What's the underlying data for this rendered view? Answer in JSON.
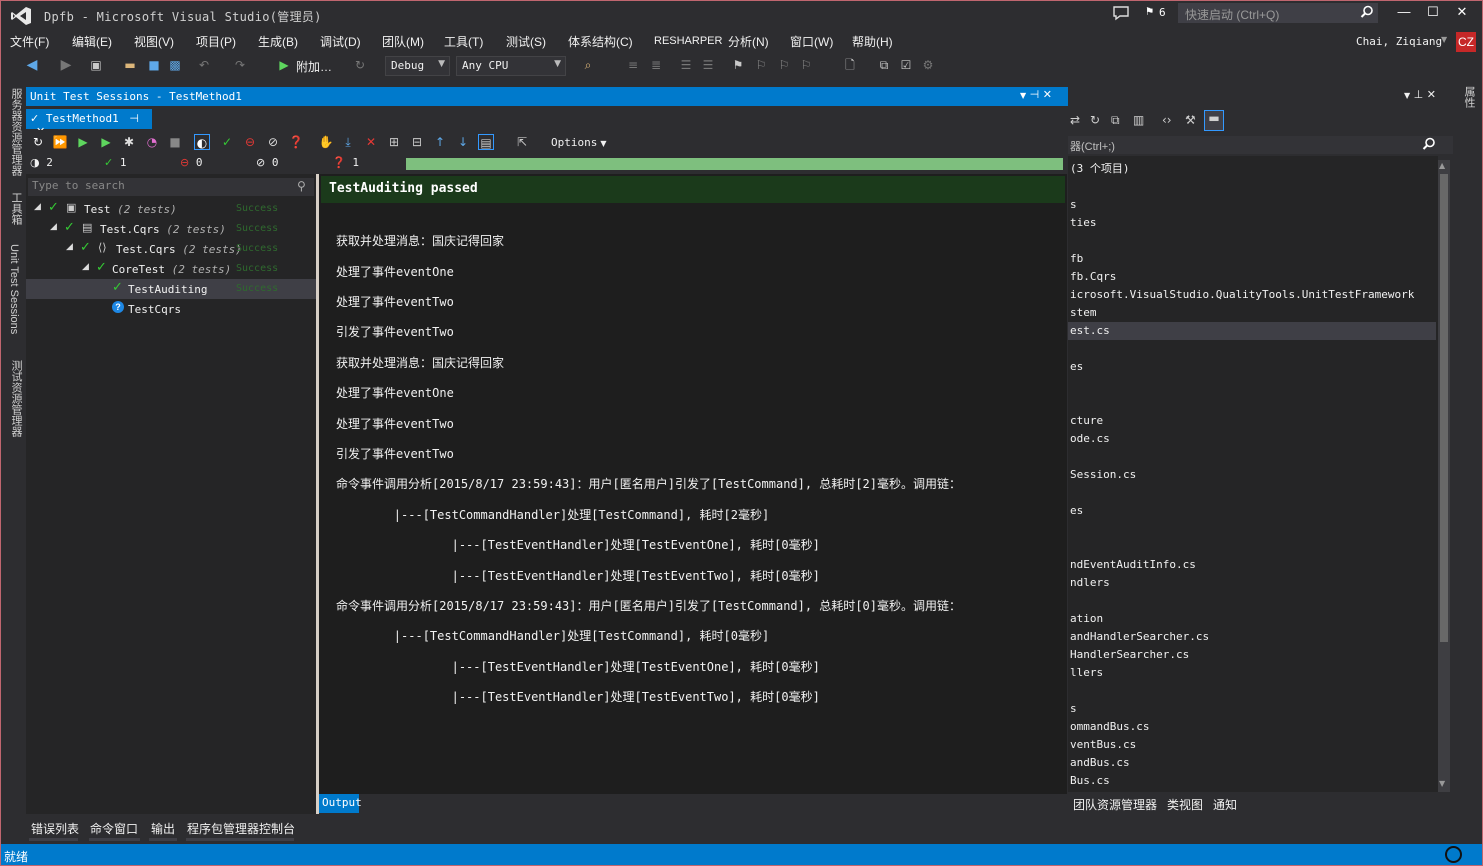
{
  "window": {
    "title": "Dpfb - Microsoft Visual Studio(管理员)",
    "notifications_count": "6",
    "quick_launch_placeholder": "快速启动 (Ctrl+Q)",
    "minimize": "—",
    "maximize": "☐",
    "close": "✕"
  },
  "menu": [
    "文件(F)",
    "编辑(E)",
    "视图(V)",
    "项目(P)",
    "生成(B)",
    "调试(D)",
    "团队(M)",
    "工具(T)",
    "测试(S)",
    "体系结构(C)",
    "RESHARPER",
    "分析(N)",
    "窗口(W)",
    "帮助(H)"
  ],
  "user": {
    "name": "Chai, Ziqiang",
    "initials": "CZ"
  },
  "toolbar": {
    "attach": "附加…",
    "configuration": "Debug",
    "platform": "Any CPU"
  },
  "left_tabs": [
    "服务器资源管理器",
    "工具箱",
    "Unit Test Sessions",
    "测试资源管理器"
  ],
  "right_tab": "属性",
  "unit_test": {
    "window_title": "Unit Test Sessions - TestMethod1",
    "tab_label": "TestMethod1",
    "options_label": "Options",
    "counts": {
      "total": "2",
      "passed": "1",
      "failed": "0",
      "ignored": "0",
      "unknown": "1"
    },
    "progress_fraction": 1.0,
    "search_placeholder": "Type to search",
    "tree": [
      {
        "label": "Test",
        "count": "(2 tests)",
        "result": "Success"
      },
      {
        "label": "Test.Cqrs",
        "count": "(2 tests)",
        "result": "Success"
      },
      {
        "label": "Test.Cqrs",
        "count": "(2 tests)",
        "result": "Success"
      },
      {
        "label": "CoreTest",
        "count": "(2 tests)",
        "result": "Success"
      },
      {
        "label": "TestAuditing",
        "count": "",
        "result": "Success"
      },
      {
        "label": "TestCqrs",
        "count": "",
        "result": ""
      }
    ],
    "output_header": "TestAuditing passed",
    "output_lines": [
      "获取并处理消息：国庆记得回家",
      "处理了事件eventOne",
      "处理了事件eventTwo",
      "引发了事件eventTwo",
      "获取并处理消息：国庆记得回家",
      "处理了事件eventOne",
      "处理了事件eventTwo",
      "引发了事件eventTwo",
      "命令事件调用分析[2015/8/17 23:59:43]：用户[匿名用户]引发了[TestCommand], 总耗时[2]毫秒。调用链：",
      "        |---[TestCommandHandler]处理[TestCommand], 耗时[2毫秒]",
      "                |---[TestEventHandler]处理[TestEventOne], 耗时[0毫秒]",
      "                |---[TestEventHandler]处理[TestEventTwo], 耗时[0毫秒]",
      "命令事件调用分析[2015/8/17 23:59:43]：用户[匿名用户]引发了[TestCommand], 总耗时[0]毫秒。调用链：",
      "        |---[TestCommandHandler]处理[TestCommand], 耗时[0毫秒]",
      "                |---[TestEventHandler]处理[TestEventOne], 耗时[0毫秒]",
      "                |---[TestEventHandler]处理[TestEventTwo], 耗时[0毫秒]"
    ],
    "output_tab": "Output"
  },
  "solution_explorer": {
    "search_placeholder": "器(Ctrl+;)",
    "items": [
      {
        "label": "(3 个项目)",
        "row": 0
      },
      {
        "label": "s",
        "row": 2
      },
      {
        "label": "ties",
        "row": 3
      },
      {
        "label": "fb",
        "row": 5
      },
      {
        "label": "fb.Cqrs",
        "row": 6
      },
      {
        "label": "icrosoft.VisualStudio.QualityTools.UnitTestFramework",
        "row": 7
      },
      {
        "label": "stem",
        "row": 8
      },
      {
        "label": "est.cs",
        "row": 9
      },
      {
        "label": "es",
        "row": 11
      },
      {
        "label": "cture",
        "row": 14
      },
      {
        "label": "ode.cs",
        "row": 15
      },
      {
        "label": "Session.cs",
        "row": 17
      },
      {
        "label": "es",
        "row": 19
      },
      {
        "label": "ndEventAuditInfo.cs",
        "row": 22
      },
      {
        "label": "ndlers",
        "row": 23
      },
      {
        "label": "ation",
        "row": 25
      },
      {
        "label": "andHandlerSearcher.cs",
        "row": 26
      },
      {
        "label": "HandlerSearcher.cs",
        "row": 27
      },
      {
        "label": "llers",
        "row": 28
      },
      {
        "label": "s",
        "row": 30
      },
      {
        "label": "ommandBus.cs",
        "row": 31
      },
      {
        "label": "ventBus.cs",
        "row": 32
      },
      {
        "label": "andBus.cs",
        "row": 33
      },
      {
        "label": "Bus.cs",
        "row": 34
      }
    ],
    "selected_row": 9,
    "tabs": [
      "团队资源管理器",
      "类视图",
      "通知"
    ]
  },
  "bottom_tabs": [
    "错误列表",
    "命令窗口",
    "输出",
    "程序包管理器控制台"
  ],
  "status": {
    "text": "就绪"
  }
}
